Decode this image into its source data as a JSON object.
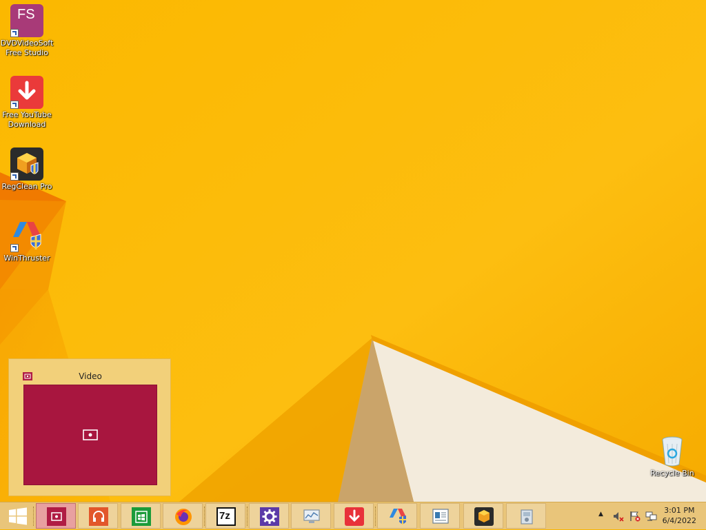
{
  "desktop": {
    "icons": [
      {
        "label_line1": "DVDVideoSoft",
        "label_line2": "Free Studio",
        "icon": "fs-icon"
      },
      {
        "label_line1": "Free YouTube",
        "label_line2": "Download",
        "icon": "download-arrow-icon"
      },
      {
        "label_line1": "RegClean Pro",
        "label_line2": "",
        "icon": "regclean-icon"
      },
      {
        "label_line1": "WinThruster",
        "label_line2": "",
        "icon": "winthruster-icon"
      }
    ],
    "fs_glyph": "FS",
    "recycle_bin": {
      "label": "Recycle Bin",
      "icon": "recycle-bin-icon"
    }
  },
  "preview": {
    "title": "Video"
  },
  "taskbar": {
    "buttons": [
      {
        "name": "video",
        "icon": "video-icon",
        "active": true,
        "color": "#b01c44"
      },
      {
        "name": "music",
        "icon": "headphones-icon",
        "active": false,
        "color": "#e2572b"
      },
      {
        "name": "store",
        "icon": "store-icon",
        "active": false,
        "color": "#1b9b3a"
      },
      {
        "name": "firefox",
        "icon": "firefox-icon",
        "active": false,
        "color": "#e66000"
      },
      {
        "name": "7zip",
        "icon": "7zip-icon",
        "active": false,
        "color": "#111111"
      },
      {
        "name": "settings",
        "icon": "gear-icon",
        "active": false,
        "color": "#5b3aa8"
      },
      {
        "name": "monitor",
        "icon": "monitor-icon",
        "active": false,
        "color": "#8aa0b8"
      },
      {
        "name": "free-youtube-download",
        "icon": "download-arrow-icon",
        "active": false,
        "color": "#e8323a"
      },
      {
        "name": "winthruster",
        "icon": "winthruster-icon",
        "active": false,
        "color": "#2a7ad6"
      },
      {
        "name": "document",
        "icon": "document-icon",
        "active": false,
        "color": "#3a7ab0"
      },
      {
        "name": "regclean",
        "icon": "regclean-icon",
        "active": false,
        "color": "#333333"
      },
      {
        "name": "installer",
        "icon": "installer-icon",
        "active": false,
        "color": "#9aaabb"
      }
    ],
    "seven_zip_glyph": "7z",
    "tray": {
      "show_hidden_glyph": "▲",
      "icons": [
        "volume-muted-icon",
        "flag-error-icon",
        "network-error-icon"
      ]
    },
    "clock": {
      "time": "3:01 PM",
      "date": "6/4/2022"
    }
  },
  "colors": {
    "wallpaper": "#f9b500",
    "taskbar": "#e9c57a",
    "accent": "#b01c44"
  }
}
